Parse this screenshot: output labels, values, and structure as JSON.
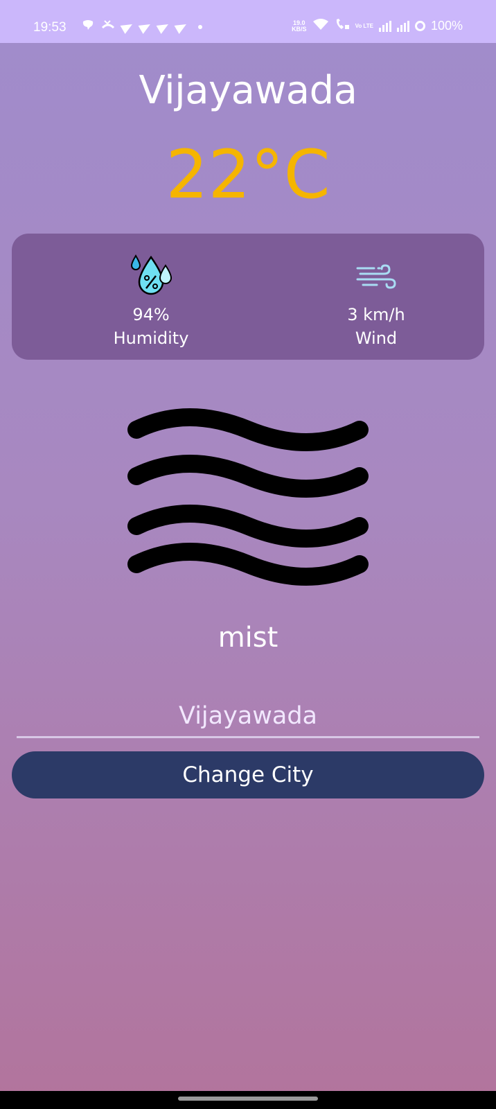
{
  "status_bar": {
    "time": "19:53",
    "net_speed_value": "19.0",
    "net_speed_unit": "KB/S",
    "volte_label": "Vo LTE",
    "battery": "100%"
  },
  "weather": {
    "city": "Vijayawada",
    "temperature": "22°C",
    "humidity_value": "94%",
    "humidity_label": "Humidity",
    "wind_value": "3 km/h",
    "wind_label": "Wind",
    "description": "mist",
    "icon": "mist-icon"
  },
  "form": {
    "city_input_value": "Vijayawada",
    "button_label": "Change City"
  },
  "colors": {
    "temperature": "#f5b500",
    "card": "#7d5c98",
    "button": "#2c3a67",
    "status_bar": "#cbb7fb"
  }
}
